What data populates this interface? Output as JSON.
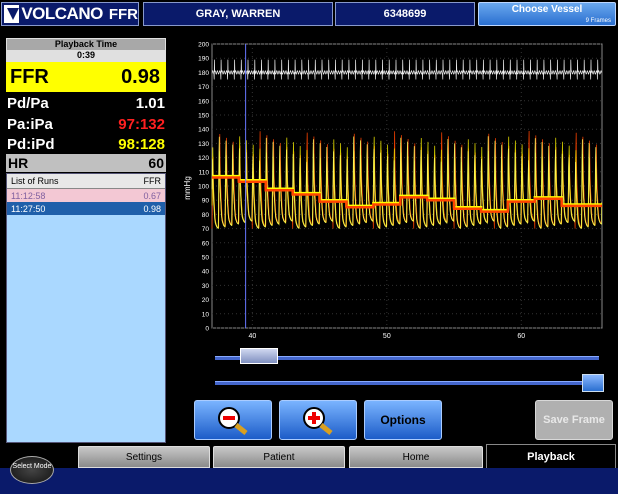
{
  "header": {
    "logo_text": "VOLCANO",
    "logo_product": "FFR",
    "patient_name": "GRAY, WARREN",
    "patient_id": "6348699",
    "choose_vessel": "Choose Vessel",
    "frames": "9 Frames"
  },
  "playback": {
    "title": "Playback Time",
    "time": "0:39"
  },
  "measurements": {
    "ffr_label": "FFR",
    "ffr_value": "0.98",
    "pdpa_label": "Pd/Pa",
    "pdpa_value": "1.01",
    "pa_label": "Pa:iPa",
    "pa_value": "97:132",
    "pd_label": "Pd:iPd",
    "pd_value": "98:128",
    "hr_label": "HR",
    "hr_value": "60"
  },
  "runs": {
    "header_label": "List of Runs",
    "header_ffr": "FFR",
    "items": [
      {
        "time": "11:12:58",
        "ffr": "0.67"
      },
      {
        "time": "11:27:50",
        "ffr": "0.98"
      }
    ]
  },
  "chart_data": {
    "type": "line",
    "ylabel": "mmHg",
    "ylim": [
      0,
      200
    ],
    "yticks": [
      "0",
      "10",
      "20",
      "30",
      "40",
      "50",
      "60",
      "70",
      "80",
      "90",
      "100",
      "110",
      "120",
      "130",
      "140",
      "150",
      "160",
      "170",
      "180",
      "190",
      "200"
    ],
    "xticks": [
      "40",
      "50",
      "60"
    ],
    "xlim": [
      37,
      66
    ],
    "cursor_x": 39.5,
    "series": [
      {
        "color": "#ffff00",
        "x": [
          37,
          39,
          41,
          43,
          45,
          47,
          49,
          51,
          53,
          55,
          57,
          59,
          61,
          63,
          65
        ],
        "values": [
          107,
          104,
          98,
          95,
          90,
          86,
          88,
          93,
          91,
          85,
          83,
          90,
          92,
          87,
          87
        ]
      },
      {
        "color": "#ff4400",
        "x": [
          37,
          39,
          41,
          43,
          45,
          47,
          49,
          51,
          53,
          55,
          57,
          59,
          61,
          63,
          65
        ],
        "values": [
          106,
          103,
          97,
          94,
          89,
          85,
          87,
          92,
          90,
          84,
          82,
          89,
          91,
          86,
          86
        ]
      }
    ],
    "ecg_baseline": 180,
    "pressure_systolic_range": [
      120,
      140
    ],
    "pressure_diastolic_range": [
      70,
      75
    ]
  },
  "controls": {
    "options_label": "Options",
    "save_label": "Save Frame"
  },
  "tabs": {
    "select_mode": "Select Mode",
    "settings": "Settings",
    "patient": "Patient",
    "home": "Home",
    "playback": "Playback"
  },
  "colors": {
    "accent": "#1c5cc8",
    "ffr_highlight": "#ffff00",
    "pa_red": "#ff2020",
    "pd_yellow": "#ffff00",
    "pressure_pa": "#ff4400",
    "pressure_pd": "#ffff00"
  }
}
